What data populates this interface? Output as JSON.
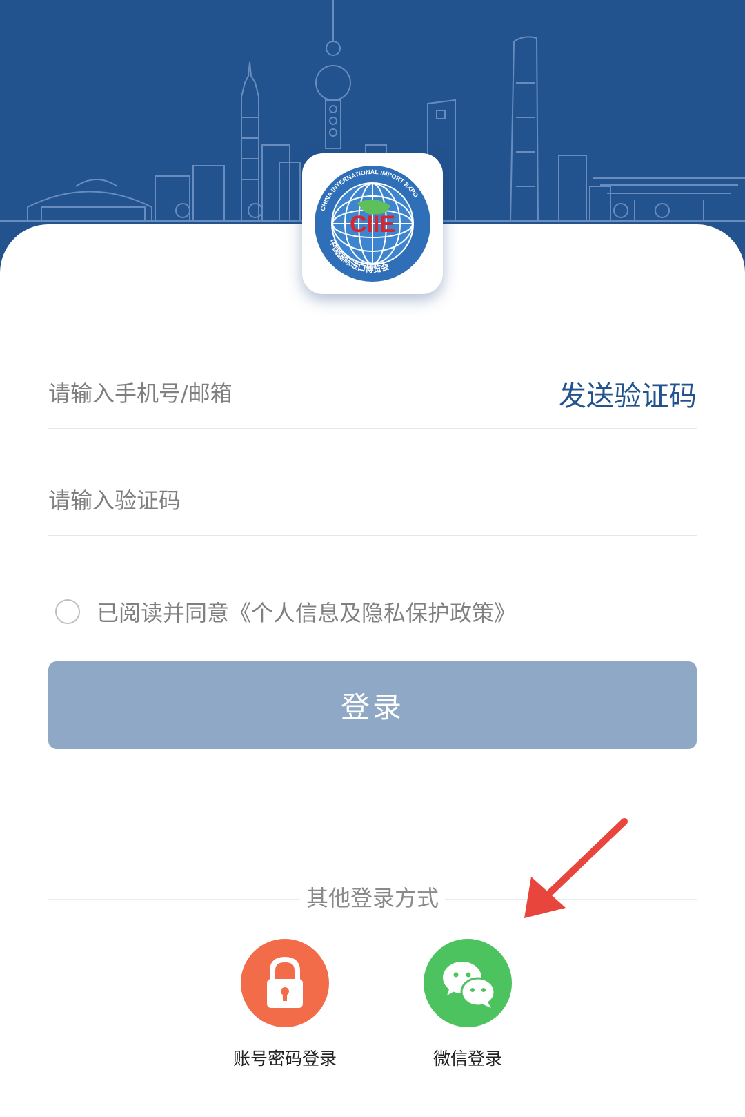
{
  "colors": {
    "brand_blue": "#23538f",
    "button_disabled": "#8fa8c6",
    "password_login": "#f26c4a",
    "wechat_green": "#4cc35e",
    "annotation_arrow": "#e8453c"
  },
  "logo": {
    "ring_text": "CHINA INTERNATIONAL IMPORT EXPO",
    "acronym": "CIIE",
    "chinese_name": "中国国际进口博览会"
  },
  "phone_field": {
    "placeholder": "请输入手机号/邮箱",
    "value": ""
  },
  "send_code_label": "发送验证码",
  "code_field": {
    "placeholder": "请输入验证码",
    "value": ""
  },
  "agreement": {
    "checked": false,
    "text": "已阅读并同意《个人信息及隐私保护政策》"
  },
  "login_button_label": "登录",
  "other_login": {
    "title": "其他登录方式",
    "options": [
      {
        "label": "账号密码登录",
        "icon": "lock-icon"
      },
      {
        "label": "微信登录",
        "icon": "wechat-icon"
      }
    ]
  }
}
